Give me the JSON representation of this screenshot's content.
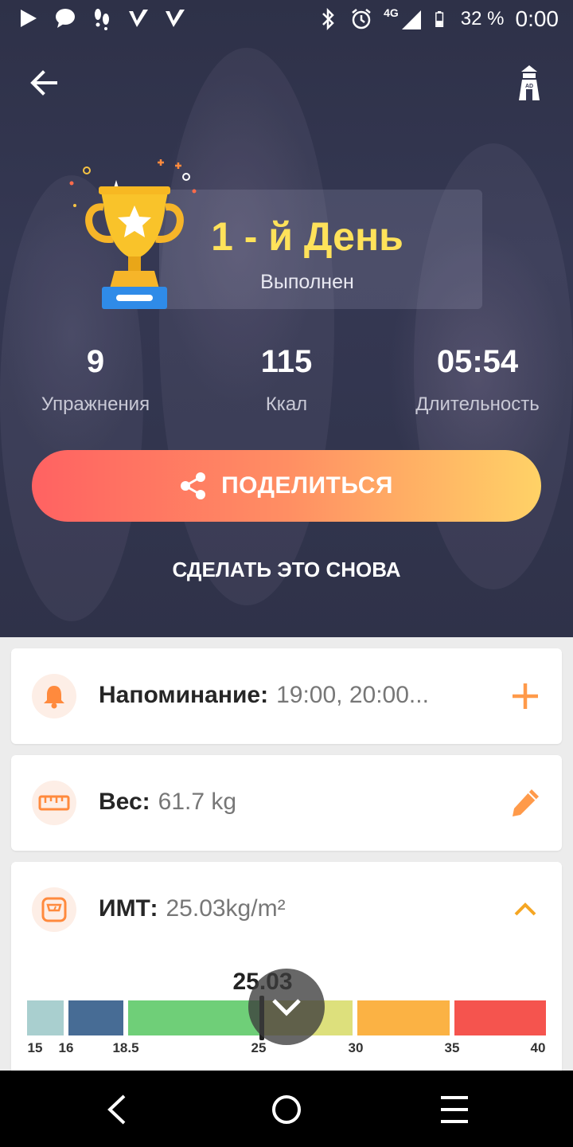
{
  "status_bar": {
    "time": "0:00",
    "battery": "32 %",
    "network": "4G",
    "icons": [
      "play-icon",
      "chat-icon",
      "footsteps-icon",
      "check-app-icon",
      "check-app-icon",
      "bluetooth-icon",
      "alarm-icon",
      "signal-icon",
      "battery-icon"
    ]
  },
  "header": {
    "back_icon": "arrow-left-icon",
    "ad_icon": "lighthouse-ad-icon"
  },
  "result": {
    "title": "1 - й День",
    "subtitle": "Выполнен",
    "trophy_icon": "trophy-icon"
  },
  "stats": [
    {
      "value": "9",
      "label": "Упражнения"
    },
    {
      "value": "115",
      "label": "Ккал"
    },
    {
      "value": "05:54",
      "label": "Длительность"
    }
  ],
  "actions": {
    "share_label": "ПОДЕЛИТЬСЯ",
    "again_label": "СДЕЛАТЬ ЭТО СНОВА"
  },
  "reminder": {
    "key": "Напоминание:",
    "value": "19:00, 20:00...",
    "icon": "bell-icon",
    "action_icon": "plus-icon"
  },
  "weight": {
    "key": "Вес:",
    "value": "61.7 kg",
    "icon": "ruler-icon",
    "action_icon": "pencil-icon"
  },
  "bmi": {
    "key": "ИМТ:",
    "value": "25.03kg/m²",
    "current": "25.03",
    "icon": "scale-icon",
    "action_icon": "chevron-up-icon",
    "ticks": [
      "15",
      "16",
      "18.5",
      "25",
      "30",
      "35",
      "40"
    ],
    "segment_colors": [
      "#a9cfcf",
      "#476c95",
      "#6fcf78",
      "#dde07c",
      "#fbb244",
      "#f5544e"
    ]
  },
  "nav": {
    "icons": [
      "back-triangle-icon",
      "home-circle-icon",
      "menu-icon"
    ]
  },
  "colors": {
    "accent": "#ff9a4a",
    "title_yellow": "#ffe25a",
    "share_gradient": [
      "#ff6262",
      "#ffd266"
    ]
  }
}
